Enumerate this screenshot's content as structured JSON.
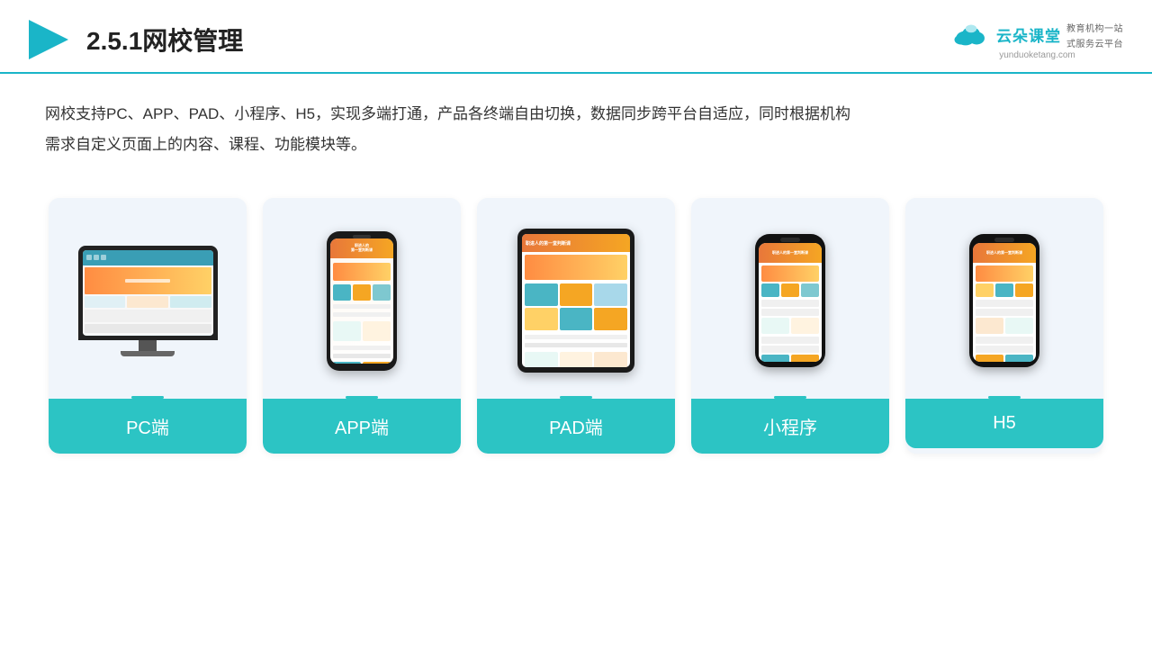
{
  "header": {
    "title": "2.5.1网校管理",
    "logo_main": "云朵课堂",
    "logo_url": "yunduoketang.com",
    "logo_sub": "教育机构一站\n式服务云平台"
  },
  "description": {
    "text": "网校支持PC、APP、PAD、小程序、H5，实现多端打通，产品各终端自由切换，数据同步跨平台自适应，同时根据机构需求自定义页面上的内容、课程、功能模块等。"
  },
  "cards": [
    {
      "id": "pc",
      "label": "PC端"
    },
    {
      "id": "app",
      "label": "APP端"
    },
    {
      "id": "pad",
      "label": "PAD端"
    },
    {
      "id": "miniapp",
      "label": "小程序"
    },
    {
      "id": "h5",
      "label": "H5"
    }
  ]
}
